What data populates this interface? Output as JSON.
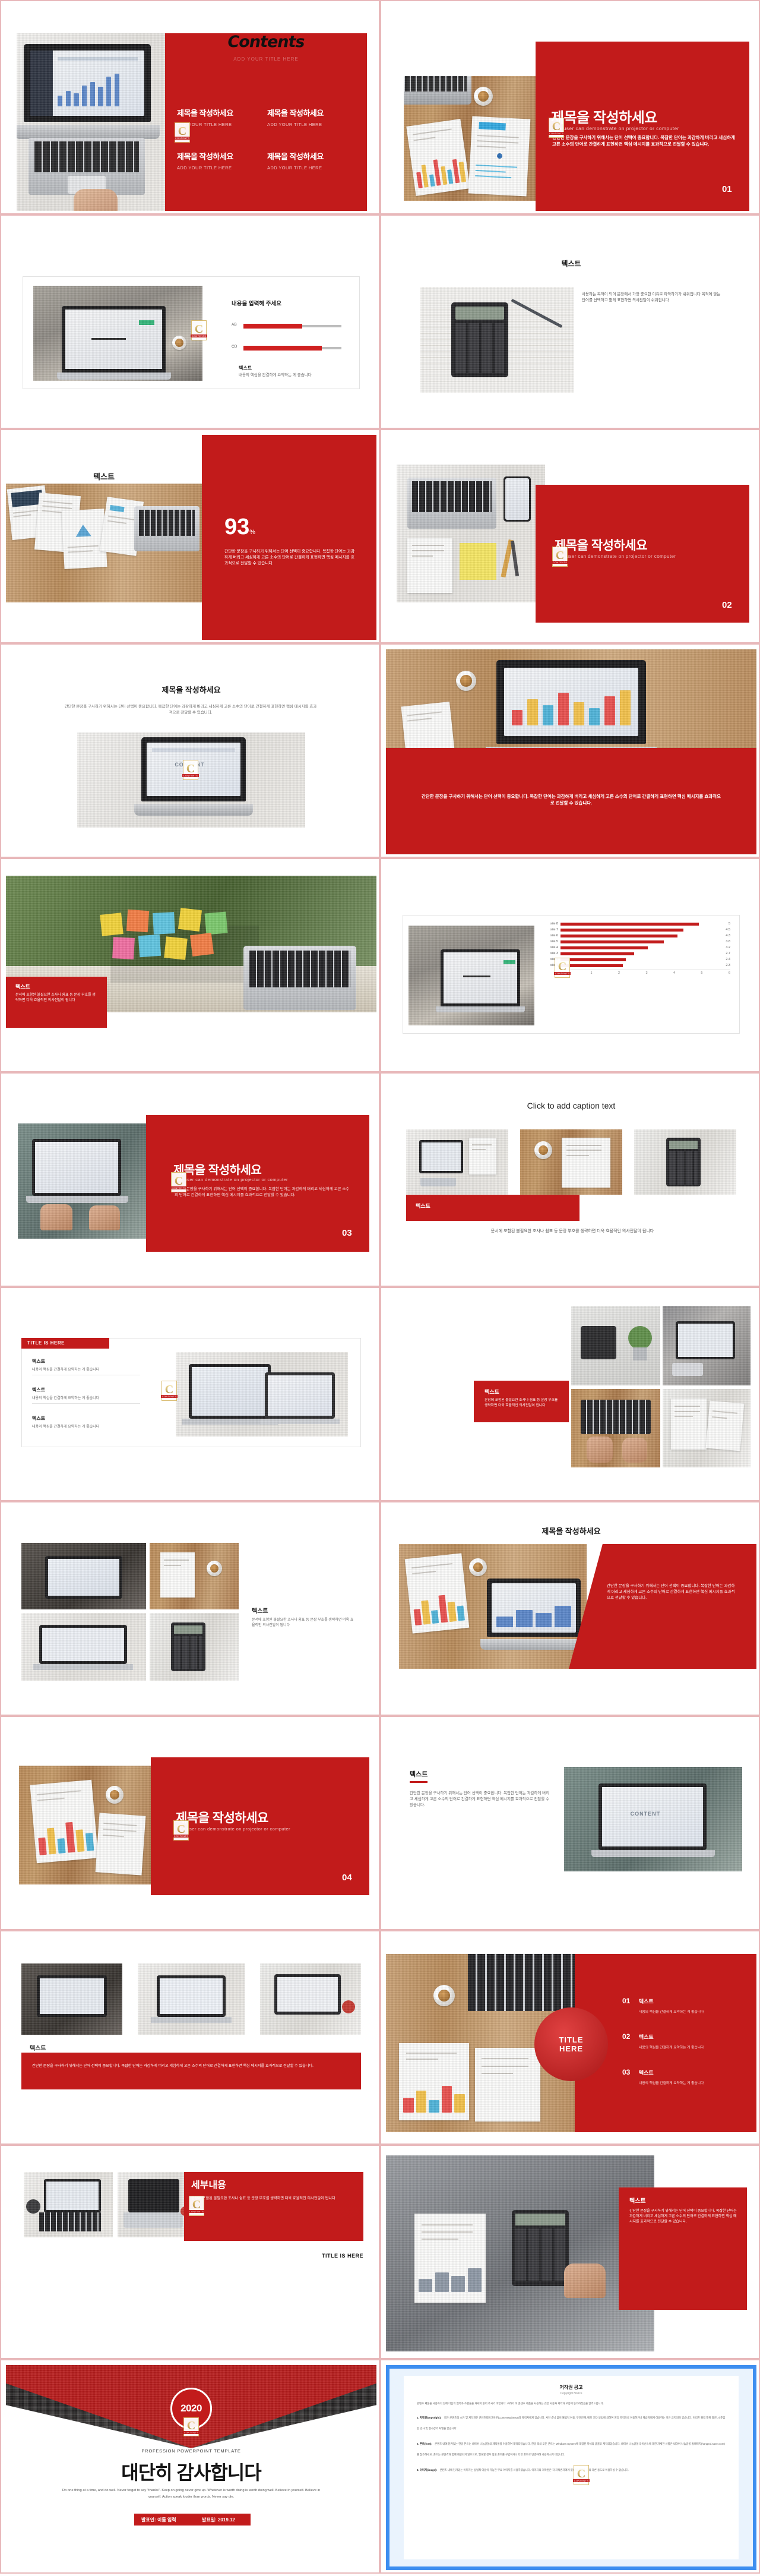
{
  "meta": {
    "accent_red": "#c21b1b",
    "frame_pink": "#e8b8ba",
    "page_kind": "powerpoint-template-preview-grid",
    "columns": 2,
    "rows": 12
  },
  "common": {
    "title_kr": "제목을 작성하세요",
    "title_en": "ADD YOUR TITLE HERE",
    "caption_en": "The user can demonstrate on projector or computer",
    "text_kr": "텍스트",
    "body_long": "간단한 문장을 구사하기 위해서는 단어 선택이 중요합니다. 복잡한 단어는 과감하게 버리고 세심하게 고른 소수의 단어로 간결하게 표현하면 핵심 메시지를 효과적으로 전달할 수 있습니다.",
    "body_short": "내용의 핵심을 간결하게 요약하는 게 좋습니다",
    "body_medium": "문장에 포함된 불필요한 조사나 쉼표 등 문장 부호를 생략하면 더욱 효율적인 의사전달이 됩니다",
    "logo_letter": "C",
    "logo_tag": "CONTENTS"
  },
  "slides": [
    {
      "id": "s01",
      "name": "contents-slide",
      "heading": "Contents",
      "sub_heading": "ADD YOUR TITLE HERE",
      "items": [
        {
          "kr": "제목을 작성하세요",
          "en": "ADD YOUR TITLE HERE"
        },
        {
          "kr": "제목을 작성하세요",
          "en": "ADD YOUR TITLE HERE"
        },
        {
          "kr": "제목을 작성하세요",
          "en": "ADD YOUR TITLE HERE"
        },
        {
          "kr": "제목을 작성하세요",
          "en": "ADD YOUR TITLE HERE"
        }
      ]
    },
    {
      "id": "s02",
      "name": "section-title-01",
      "title_kr": "제목을 작성하세요",
      "caption_en": "The user can demonstrate on projector or computer",
      "body": "간단한 문장을 구사하기 위해서는 단어 선택이 중요합니다. 복잡한 단어는 과감하게 버리고 세심하게 고른 소수의 단어로 간결하게 표현하면 핵심 메시지를 효과적으로 전달할 수 있습니다.",
      "number": "01"
    },
    {
      "id": "s03",
      "name": "progress-bars-slide",
      "heading": "내용을 입력해 주세요",
      "bars": [
        {
          "label": "AB",
          "value": 60
        },
        {
          "label": "CD",
          "value": 80
        }
      ],
      "sub_title": "텍스트",
      "sub_body": "내용의 핵심을 간결하게 요약하는 게 좋습니다"
    },
    {
      "id": "s04",
      "name": "text-with-calculator-photo",
      "heading": "텍스트",
      "body": "사용하는 목적이 되어 문장에서 가장 중요한 이유로 파악하기가 쉬워집니다 목적에 맞는 단어를 선택하고 짧게 표현하면 의사전달이 쉬워집니다"
    },
    {
      "id": "s05",
      "name": "percent-93-slide",
      "heading": "텍스트",
      "percent_value": "93",
      "percent_unit": "%",
      "body": "간단한 문장을 구사하기 위해서는 단어 선택이 중요합니다. 복잡한 단어는 과감하게 버리고 세심하게 고른 소수의 단어로 간결하게 표현하면 핵심 메시지를 효과적으로 전달할 수 있습니다."
    },
    {
      "id": "s06",
      "name": "section-title-02",
      "title_kr": "제목을 작성하세요",
      "caption_en": "The user can demonstrate on projector or computer",
      "number": "02"
    },
    {
      "id": "s07",
      "name": "title-with-laptop-photo",
      "title_kr": "제목을 작성하세요",
      "body": "간단한 문장을 구사하기 위해서는 단어 선택이 중요합니다. 복잡한 단어는 과감하게 버리고 세심하게 고른 소수의 단어로 간결하게 표현하면 핵심 메시지를 효과적으로 전달할 수 있습니다."
    },
    {
      "id": "s08",
      "name": "laptop-with-red-caption-band",
      "body": "간단한 문장을 구사하기 위해서는 단어 선택이 중요합니다. 복잡한 단어는 과감하게 버리고 세심하게 고른 소수의 단어로 간결하게 표현하면 핵심 메시지를 효과적으로 전달할 수 있습니다."
    },
    {
      "id": "s09",
      "name": "sticky-notes-text-slide",
      "heading": "텍스트",
      "body": "문서에 포함된 불필요한 조사나 쉼표 등 문장 부호를 생략하면 더욱 효율적인 의사전달이 됩니다"
    },
    {
      "id": "s10",
      "name": "horizontal-bar-chart-slide",
      "chart_ref": "site-ranking"
    },
    {
      "id": "s11",
      "name": "section-title-03",
      "title_kr": "제목을 작성하세요",
      "caption_en": "The user can demonstrate on projector or computer",
      "body": "간단한 문장을 구사하기 위해서는 단어 선택이 중요합니다. 복잡한 단어는 과감하게 버리고 세심하게 고른 소수의 단어로 간결하게 표현하면 핵심 메시지를 효과적으로 전달할 수 있습니다.",
      "number": "03"
    },
    {
      "id": "s12",
      "name": "caption-text-three-photos",
      "heading": "Click to add caption text",
      "label": "텍스트",
      "body": "문서에 포함된 불필요한 조사나 쉼표 등 문장 부호를 생략하면 더욱 효율적인 의사전달이 됩니다"
    },
    {
      "id": "s13",
      "name": "title-is-here-list-slide",
      "heading": "TITLE IS HERE",
      "items": [
        {
          "title": "텍스트",
          "body": "내용의 핵심을 간결하게 요약하는 게 좋습니다"
        },
        {
          "title": "텍스트",
          "body": "내용의 핵심을 간결하게 요약하는 게 좋습니다"
        },
        {
          "title": "텍스트",
          "body": "내용의 핵심을 간결하게 요약하는 게 좋습니다"
        }
      ]
    },
    {
      "id": "s14",
      "name": "four-photo-grid-text",
      "heading": "텍스트",
      "body": "문장에 포함된 불필요한 조사나 쉼표 등 문장 부호를 생략하면 더욱 효율적인 의사전달이 됩니다"
    },
    {
      "id": "s15",
      "name": "text-left-photos",
      "heading": "텍스트",
      "body": "문서에 포함된 불필요한 조사나 쉼표 등 문장 부호를 생략하면 더욱 효율적인 의사전달이 됩니다"
    },
    {
      "id": "s16",
      "name": "title-red-diagonal-slide",
      "heading": "제목을 작성하세요",
      "body": "간단한 문장을 구사하기 위해서는 단어 선택이 중요합니다. 복잡한 단어는 과감하게 버리고 세심하게 고른 소수의 단어로 간결하게 표현하면 핵심 메시지를 효과적으로 전달할 수 있습니다."
    },
    {
      "id": "s17",
      "name": "section-title-04",
      "title_kr": "제목을 작성하세요",
      "caption_en": "The user can demonstrate on projector or computer",
      "number": "04"
    },
    {
      "id": "s18",
      "name": "text-content-right-photo",
      "heading": "텍스트",
      "body": "간단한 문장을 구사하기 위해서는 단어 선택이 중요합니다. 복잡한 단어는 과감하게 버리고 세심하게 고른 소수의 단어로 간결하게 표현하면 핵심 메시지를 효과적으로 전달할 수 있습니다."
    },
    {
      "id": "s19",
      "name": "three-photo-text-band",
      "heading": "텍스트",
      "body": "간단한 문장을 구사하기 위해서는 단어 선택이 중요합니다. 복잡한 단어는 과감하게 버리고 세심하게 고른 소수의 단어로 간결하게 표현하면 핵심 메시지를 효과적으로 전달할 수 있습니다."
    },
    {
      "id": "s20",
      "name": "title-here-circle-list",
      "circle_line1": "TITLE",
      "circle_line2": "HERE",
      "items": [
        {
          "num": "01",
          "title": "텍스트",
          "body": "내용의 핵심을 간결하게 요약하는 게 좋습니다"
        },
        {
          "num": "02",
          "title": "텍스트",
          "body": "내용의 핵심을 간결하게 요약하는 게 좋습니다"
        },
        {
          "num": "03",
          "title": "텍스트",
          "body": "내용의 핵심을 간결하게 요약하는 게 좋습니다"
        }
      ]
    },
    {
      "id": "s21",
      "name": "detail-content-slide",
      "heading": "세부내용",
      "body": "문장에 포함된 불필요한 조사나 쉼표 등 문장 부호를 생략하면 더욱 효율적인 의사전달이 됩니다",
      "footer": "TITLE IS HERE"
    },
    {
      "id": "s22",
      "name": "text-right-red-panel",
      "heading": "텍스트",
      "body": "간단한 문장을 구사하기 위해서는 단어 선택이 중요합니다. 복잡한 단어는 과감하게 버리고 세심하게 고른 소수의 단어로 간결하게 표현하면 핵심 메시지를 효과적으로 전달할 수 있습니다."
    },
    {
      "id": "s23",
      "name": "thank-you-slide",
      "year": "2020",
      "kicker": "PROFESSION POWERPOINT TEMPLATE",
      "title": "대단히 감사합니다",
      "body_en": "Do one thing at a time, and do well. Never forget to say \"thanks\". Keep on going never give up. Whatever is worth doing is worth doing well. Believe in yourself. Believe in yourself. Action speak louder than words. Never say die.",
      "presenter": "발표인: 이름 입력",
      "date": "발표일: 2019.12"
    },
    {
      "id": "s24",
      "name": "copyright-slide",
      "title": "저작권 공고",
      "subtitle": "Copyright Notice",
      "intro": "콘텐츠 제품을 사용하기 전에 다음의 협약과 조항들을 자세히 읽어 주시기 바랍니다. 귀하가 이 콘텐츠 제품을 사용하는 것은 사용자 계약과 보증에 동의하셨음을 알려드립니다.",
      "sections": [
        {
          "head": "1. 저작권(copyright):",
          "text": "모든 콘텐츠의 소유 및 저작권은 콘텐츠테이크아웃(Contentstakeout)과 제작자에게 있습니다. 사전 승낙 없이 불법적 이용, 무단전재, 배포 기타 방법에 의하여 영리 목적으로 이용하거나 제삼자에게 이용하는 것은 금지되어 있습니다. 이러한 불법 행위 발견 시 준엄한 민사 및 형사상의 처벌을 받습니다."
        },
        {
          "head": "2. 폰트(font):",
          "text": "콘텐츠 내에 담겨있는 한글 폰트는 네이버 나눔글꼴의 제작물을 이용하여 제작되었습니다. 한글 외의 모든 폰트는 Windows System에 포함된 자체의 글꼴로 제작되었습니다. 네이버 나눔글꼴 라이선스에 대한 자세한 사항은 네이버 나눔글꼴 홈페이지(hangeul.naver.com)를 참조하세요. 폰트는 콘텐츠와 함께 제공되지 않으므로, 필요할 경우 정품 폰트를 구입하거나 다른 폰트로 변경하여 사용하시기 바랍니다."
        },
        {
          "head": "3. 이미지(image):",
          "text": "콘텐츠 내에 담겨있는 이미지는 상업적 이용이 가능한 무료 이미지를 사용하였습니다. 이미지의 저작권은 각 저작권자에게 있으며 콘텐츠 외의 다른 용도로 이용하실 수 없습니다."
        }
      ]
    }
  ],
  "chart_data": {
    "type": "bar",
    "orientation": "horizontal",
    "title": "",
    "xlabel": "",
    "ylabel": "",
    "categories": [
      "site 1",
      "site 2",
      "site 3",
      "site 4",
      "site 5",
      "site 6",
      "site 7",
      "site 8"
    ],
    "values": [
      2.3,
      2.4,
      2.7,
      3.2,
      3.8,
      4.3,
      4.5,
      5
    ],
    "xlim": [
      0,
      6
    ],
    "xticks": [
      0,
      1,
      2,
      3,
      4,
      5,
      6
    ],
    "grid": false,
    "legend": false,
    "bar_color": "#c21b1b",
    "data_labels": [
      "2.3",
      "2.4",
      "2.7",
      "3.2",
      "3.8",
      "4.3",
      "4.5",
      "5"
    ]
  }
}
